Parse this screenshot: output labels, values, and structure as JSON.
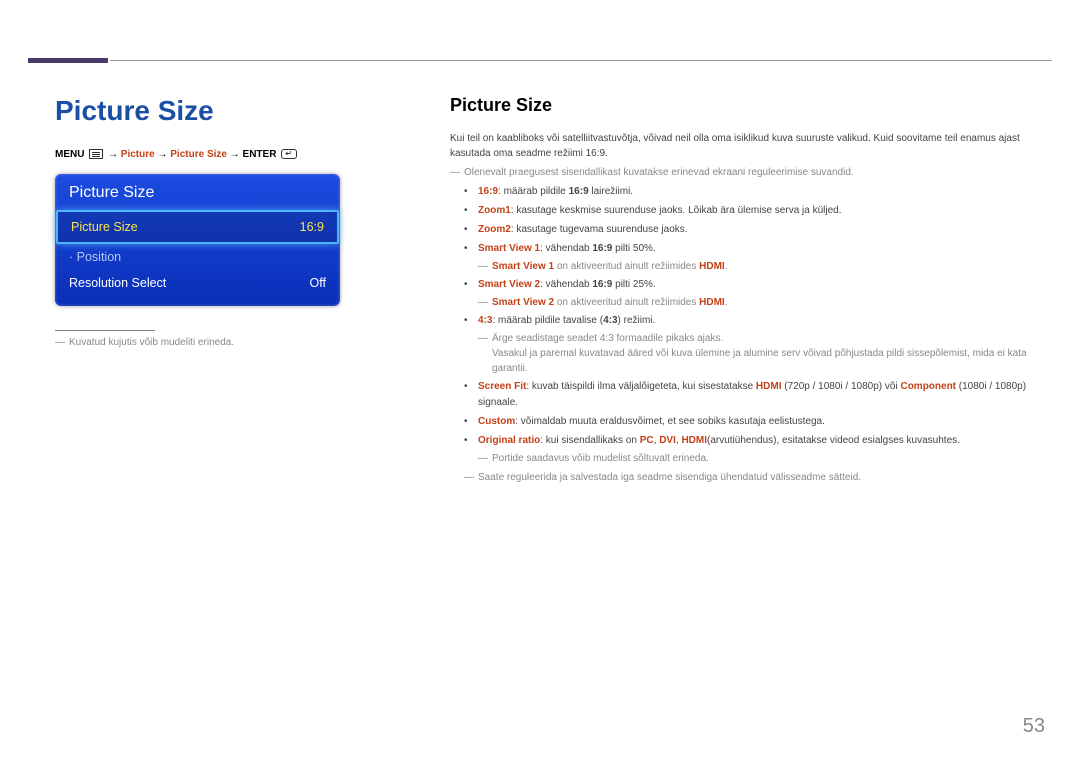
{
  "header": {
    "page_number": "53"
  },
  "left": {
    "title": "Picture Size",
    "breadcrumb": {
      "p1": "MENU",
      "arrow": "→",
      "p2": "Picture",
      "p3": "Picture Size",
      "p4": "ENTER"
    },
    "osd": {
      "title": "Picture Size",
      "rows": [
        {
          "label": "Picture Size",
          "value": "16:9",
          "state": "highlight"
        },
        {
          "label": "· Position",
          "value": "",
          "state": "disabled"
        },
        {
          "label": "Resolution Select",
          "value": "Off",
          "state": "normal"
        }
      ]
    },
    "disclaimer": "Kuvatud kujutis võib mudeliti erineda."
  },
  "right": {
    "title": "Picture Size",
    "intro": "Kui teil on kaabliboks või satelliitvastuvõtja, võivad neil olla oma isiklikud kuva suuruste valikud. Kuid soovitame teil enamus ajast kasutada oma seadme režiimi 16:9.",
    "note1": "Olenevalt praegusest sisendallikast kuvatakse erinevad ekraani reguleerimise suvandid.",
    "bullets": {
      "b16_9_a": "16:9",
      "b16_9_b": ": määrab pildile ",
      "b16_9_c": "16:9",
      "b16_9_d": " lairežiimi.",
      "bzoom1_a": "Zoom1",
      "bzoom1_b": ": kasutage keskmise suurenduse jaoks. Lõikab ära ülemise serva ja küljed.",
      "bzoom2_a": "Zoom2",
      "bzoom2_b": ": kasutage tugevama suurenduse jaoks.",
      "bsv1_a": "Smart View 1",
      "bsv1_b": ": vähendab ",
      "bsv1_c": "16:9",
      "bsv1_d": " pilti 50%.",
      "sv1_note_a": "Smart View 1",
      "sv1_note_b": " on aktiveeritud ainult režiimides ",
      "sv1_note_c": "HDMI",
      "sv1_note_d": ".",
      "bsv2_a": "Smart View 2",
      "bsv2_b": ": vähendab ",
      "bsv2_c": "16:9",
      "bsv2_d": " pilti 25%.",
      "sv2_note_a": "Smart View 2",
      "sv2_note_b": " on aktiveeritud ainult režiimides ",
      "sv2_note_c": "HDMI",
      "sv2_note_d": ".",
      "b4_3_a": "4:3",
      "b4_3_b": ": määrab pildile tavalise (",
      "b4_3_c": "4:3",
      "b4_3_d": ") režiimi.",
      "b4_3_note1": "Ärge seadistage seadet 4:3 formaadile pikaks ajaks.",
      "b4_3_note2": "Vasakul ja paremal kuvatavad ääred või kuva ülemine ja alumine serv võivad põhjustada pildi sissepõlemist, mida ei kata garantii.",
      "bsf_a": "Screen Fit",
      "bsf_b": ": kuvab täispildi ilma väljalõigeteta, kui sisestatakse ",
      "bsf_c": "HDMI",
      "bsf_d": " (720p / 1080i / 1080p) või ",
      "bsf_e": "Component",
      "bsf_f": " (1080i / 1080p) signaale.",
      "bcustom_a": "Custom",
      "bcustom_b": ": võimaldab muuta eraldusvõimet, et see sobiks kasutaja eelistustega.",
      "borig_a": "Original ratio",
      "borig_b": ": kui sisendallikaks on ",
      "borig_c": "PC",
      "borig_d": ", ",
      "borig_e": "DVI",
      "borig_f": ", ",
      "borig_g": "HDMI",
      "borig_h": "(arvutiühendus), esitatakse videod esialgses kuvasuhtes.",
      "post_note1": "Portide saadavus võib mudelist sõltuvalt erineda.",
      "post_note2": "Saate reguleerida ja salvestada iga seadme sisendiga ühendatud välisseadme sätteid."
    }
  }
}
